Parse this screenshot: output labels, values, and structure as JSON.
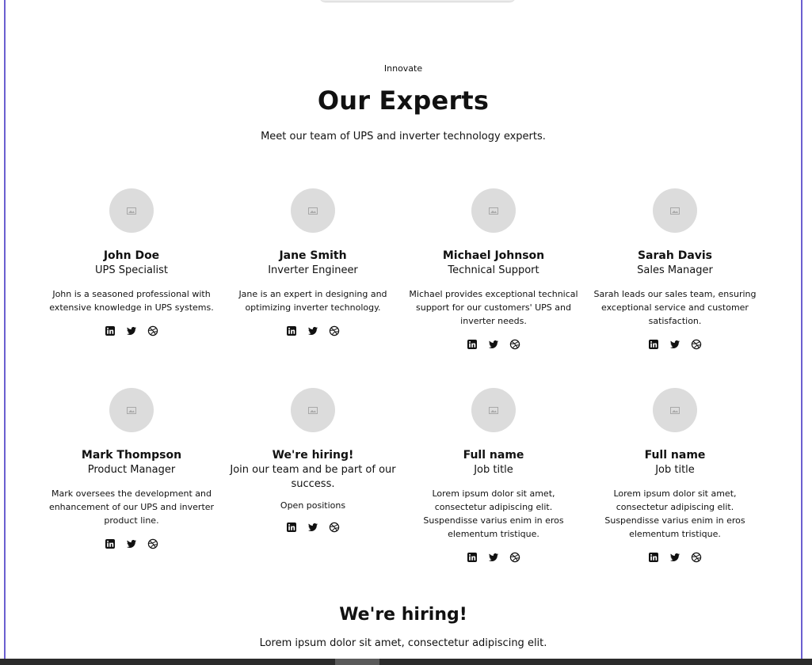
{
  "section": {
    "tagline": "Innovate",
    "title": "Our Experts",
    "subtitle": "Meet our team of UPS and inverter technology experts."
  },
  "team": [
    {
      "name": "John Doe",
      "role": "UPS Specialist",
      "desc": "John is a seasoned professional with extensive knowledge in UPS systems."
    },
    {
      "name": "Jane Smith",
      "role": "Inverter Engineer",
      "desc": "Jane is an expert in designing and optimizing inverter technology."
    },
    {
      "name": "Michael Johnson",
      "role": "Technical Support",
      "desc": "Michael provides exceptional technical support for our customers' UPS and inverter needs."
    },
    {
      "name": "Sarah Davis",
      "role": "Sales Manager",
      "desc": "Sarah leads our sales team, ensuring exceptional service and customer satisfaction."
    },
    {
      "name": "Mark Thompson",
      "role": "Product Manager",
      "desc": "Mark oversees the development and enhancement of our UPS and inverter product line."
    },
    {
      "name": "We're hiring!",
      "role": "Join our team and be part of our success.",
      "link": "Open positions"
    },
    {
      "name": "Full name",
      "role": "Job title",
      "desc": "Lorem ipsum dolor sit amet, consectetur adipiscing elit. Suspendisse varius enim in eros elementum tristique."
    },
    {
      "name": "Full name",
      "role": "Job title",
      "desc": "Lorem ipsum dolor sit amet, consectetur adipiscing elit. Suspendisse varius enim in eros elementum tristique."
    }
  ],
  "social_icons": [
    "linkedin-icon",
    "twitter-icon",
    "dribbble-icon"
  ],
  "hiring": {
    "title": "We're hiring!",
    "subtitle": "Lorem ipsum dolor sit amet, consectetur adipiscing elit."
  },
  "colors": {
    "frame_border": "#6b5fd0",
    "avatar_bg": "#dcdcdc",
    "text": "#111111"
  }
}
